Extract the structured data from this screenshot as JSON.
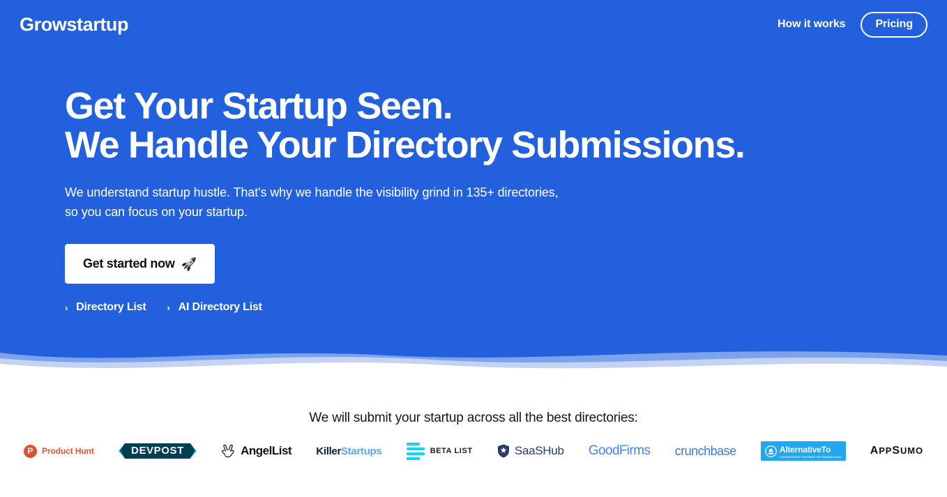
{
  "nav": {
    "brand": "Growstartup",
    "how_it_works": "How it works",
    "pricing": "Pricing"
  },
  "hero": {
    "headline_line1": "Get Your Startup Seen.",
    "headline_line2": "We Handle Your Directory Submissions.",
    "sub_line1": "We understand startup hustle. That's why we handle the visibility grind in 135+ directories,",
    "sub_line2": "so you can focus on your startup.",
    "cta_label": "Get started now",
    "cta_icon": "rocket-icon",
    "cta_icon_glyph": "🚀",
    "quicklinks": [
      {
        "chevron": "›",
        "label": "Directory List"
      },
      {
        "chevron": "›",
        "label": "AI Directory List"
      }
    ],
    "background_color": "#2360dd"
  },
  "logos": {
    "title": "We will submit your startup across all the best directories:",
    "items": [
      {
        "name": "Product Hunt",
        "mark": "P"
      },
      {
        "name": "DEVPOST"
      },
      {
        "name": "AngelList",
        "icon": "peace-hand-icon"
      },
      {
        "name_part1": "Killer",
        "name_part2": "Startups"
      },
      {
        "name": "BETA LIST"
      },
      {
        "name": "SaaSHub",
        "icon": "shield-star-icon"
      },
      {
        "name": "GoodFirms"
      },
      {
        "name": "crunchbase"
      },
      {
        "name": "AlternativeTo",
        "tagline": "CROWDSOURCED SOFTWARE RECOMMENDATIONS"
      },
      {
        "name_part1": "A",
        "name_part2": "PP",
        "name_part3": "S",
        "name_part4": "UMO"
      }
    ]
  },
  "colors": {
    "hero_blue": "#2360dd",
    "product_hunt": "#da552f",
    "devpost_dark": "#003e54",
    "devpost_accent": "#2ec5d3",
    "killer_dark": "#0c1b33",
    "startups_blue": "#5ba8f0",
    "betalist_cyan": "#12d6f5",
    "saashub_navy": "#2b3c6b",
    "goodfirms_blue": "#4285f4",
    "crunchbase_blue": "#3b78e7",
    "alternativeto_blue": "#21a8f0"
  }
}
